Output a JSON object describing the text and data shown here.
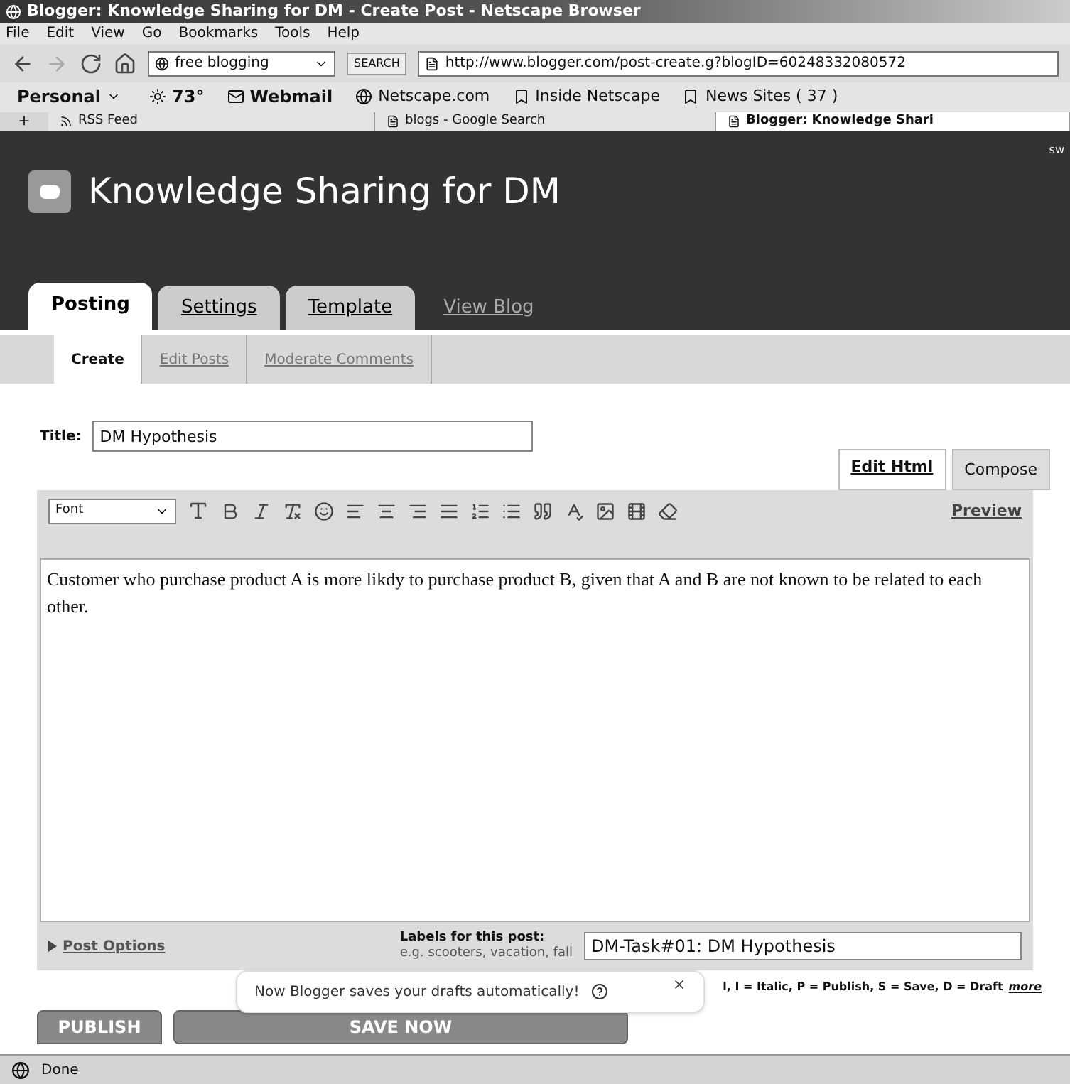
{
  "window": {
    "title": "Blogger: Knowledge Sharing for DM - Create Post - Netscape Browser"
  },
  "menu": [
    "File",
    "Edit",
    "View",
    "Go",
    "Bookmarks",
    "Tools",
    "Help"
  ],
  "navigation": {
    "search_value": "free blogging",
    "search_button": "SEARCH",
    "address": "http://www.blogger.com/post-create.g?blogID=60248332080572"
  },
  "personal_bar": [
    {
      "kind": "menu",
      "label": "Personal"
    },
    {
      "kind": "weather",
      "label": "73°"
    },
    {
      "kind": "mail",
      "label": "Webmail"
    },
    {
      "kind": "link",
      "label": "Netscape.com"
    },
    {
      "kind": "menu-link",
      "label": "Inside Netscape"
    },
    {
      "kind": "menu-link",
      "label": "News Sites ( 37 )"
    }
  ],
  "browser_tabs": [
    {
      "label": "RSS Feed",
      "selected": false
    },
    {
      "label": "blogs - Google Search",
      "selected": false
    },
    {
      "label": "Blogger: Knowledge Shari",
      "selected": true
    }
  ],
  "blog": {
    "title": "Knowledge Sharing for DM",
    "corner_text": "sw"
  },
  "tabs": [
    {
      "label": "Posting",
      "selected": true
    },
    {
      "label": "Settings",
      "selected": false
    },
    {
      "label": "Template",
      "selected": false
    },
    {
      "label": "View Blog",
      "selected": false
    }
  ],
  "subtabs": [
    {
      "label": "Create",
      "selected": true
    },
    {
      "label": "Edit Posts",
      "selected": false
    },
    {
      "label": "Moderate Comments",
      "selected": false
    }
  ],
  "post": {
    "title_label": "Title:",
    "title_value": "DM Hypothesis",
    "body": "Customer who purchase product A is more likdy to purchase product B, given that A and B are not known to be related to each other."
  },
  "editor_modes": [
    {
      "label": "Edit Html",
      "selected": false
    },
    {
      "label": "Compose",
      "selected": true
    }
  ],
  "toolbar": {
    "font": "Font",
    "preview": "Preview"
  },
  "post_options": "Post Options",
  "labels": {
    "label": "Labels for this post:",
    "hint": "e.g. scooters, vacation, fall",
    "value": "DM-Task#01: DM Hypothesis"
  },
  "shortcuts": {
    "text": "l, I = Italic, P = Publish, S = Save, D = Draft",
    "link": "more"
  },
  "tooltip": "Now Blogger saves your drafts automatically!",
  "buttons": [
    "PUBLISH",
    "SAVE NOW"
  ],
  "status_bar": "Done"
}
